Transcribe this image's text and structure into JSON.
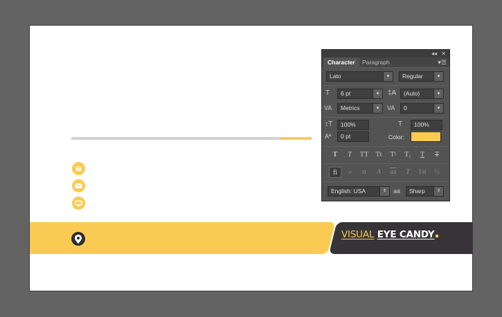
{
  "artboard": {
    "logo": {
      "word1": "VISUAL",
      "word2": "EYE CANDY"
    },
    "contact_icons": [
      "phone-icon",
      "email-icon",
      "monitor-icon"
    ],
    "location_icon": "map-pin-icon",
    "colors": {
      "yellow": "#f9cb52",
      "dark": "#363436",
      "gray_rule": "#d2d2d2"
    }
  },
  "panel": {
    "tabs": [
      {
        "label": "Character",
        "active": true
      },
      {
        "label": "Paragraph",
        "active": false
      }
    ],
    "font_family": "Lato",
    "font_style": "Regular",
    "font_size": "6 pt",
    "leading": "(Auto)",
    "kerning": "Metrics",
    "tracking": "0",
    "vertical_scale": "100%",
    "horizontal_scale": "100%",
    "baseline_shift": "0 pt",
    "color_label": "Color:",
    "color_value": "#f9cb52",
    "type_styles": [
      "T",
      "T",
      "TT",
      "Tt",
      "T¹",
      "T₁",
      "T",
      "T"
    ],
    "opentype": [
      "fi",
      "ℴ",
      "st",
      "A",
      "aa",
      "T",
      "1st",
      "½"
    ],
    "language": "English: USA",
    "antialias_icon": "aa",
    "antialias": "Sharp"
  }
}
